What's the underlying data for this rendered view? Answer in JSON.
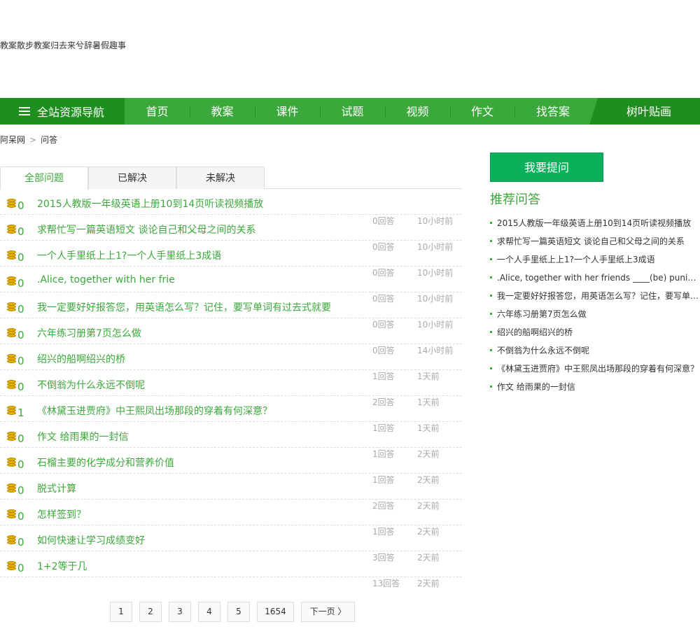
{
  "top_links": "教案散步教案归去来兮辞暑假趣事",
  "nav": {
    "all_label": "全站资源导航",
    "items": [
      "首页",
      "教案",
      "课件",
      "试题",
      "视频",
      "作文",
      "找答案"
    ],
    "right_label": "树叶贴画"
  },
  "breadcrumb": {
    "home": "阿呆网",
    "sep": ">",
    "current": "问答"
  },
  "tabs": [
    "全部问题",
    "已解决",
    "未解决"
  ],
  "questions": [
    {
      "score": "0",
      "title": "2015人教版一年级英语上册10到14页听读视频播放",
      "answers": "0回答",
      "time": "10小时前"
    },
    {
      "score": "0",
      "title": "求帮忙写一篇英语短文 谈论自己和父母之间的关系",
      "answers": "0回答",
      "time": "10小时前"
    },
    {
      "score": "0",
      "title": "一个人手里纸上上1?一个人手里纸上3成语",
      "answers": "0回答",
      "time": "10小时前"
    },
    {
      "score": "0",
      "title": ".Alice, together with her frie",
      "answers": "0回答",
      "time": "10小时前"
    },
    {
      "score": "0",
      "title": "我一定要好好报答您，用英语怎么写？记住，要写单词有过去式就要",
      "answers": "0回答",
      "time": "10小时前"
    },
    {
      "score": "0",
      "title": "六年练习册第7页怎么做",
      "answers": "0回答",
      "time": "14小时前"
    },
    {
      "score": "0",
      "title": "绍兴的船啊绍兴的桥",
      "answers": "1回答",
      "time": "1天前"
    },
    {
      "score": "0",
      "title": "不倒翁为什么永远不倒呢",
      "answers": "2回答",
      "time": "1天前"
    },
    {
      "score": "1",
      "title": "《林黛玉进贾府》中王熙凤出场那段的穿着有何深意？",
      "answers": "1回答",
      "time": "1天前"
    },
    {
      "score": "0",
      "title": "作文 给雨果的一封信",
      "answers": "1回答",
      "time": "2天前"
    },
    {
      "score": "0",
      "title": "石榴主要的化学成分和营养价值",
      "answers": "1回答",
      "time": "2天前"
    },
    {
      "score": "0",
      "title": "脱式计算",
      "answers": "2回答",
      "time": "2天前"
    },
    {
      "score": "0",
      "title": "怎样签到？",
      "answers": "1回答",
      "time": "2天前"
    },
    {
      "score": "0",
      "title": "如何快速让学习成绩变好",
      "answers": "3回答",
      "time": "2天前"
    },
    {
      "score": "0",
      "title": "1+2等于几",
      "answers": "13回答",
      "time": "2天前"
    }
  ],
  "pager": [
    "1",
    "2",
    "3",
    "4",
    "5",
    "1654",
    "下一页 〉"
  ],
  "sidebar": {
    "ask_label": "我要提问",
    "rec_title": "推荐问答",
    "rec_items": [
      "2015人教版一年级英语上册10到14页听读视频播放",
      "求帮忙写一篇英语短文 谈论自己和父母之间的关系",
      "一个人手里纸上上1?一个人手里纸上3成语",
      ".Alice, together with her friends ____(be) punished",
      "我一定要好好报答您，用英语怎么写？记住，要写单词有过去式就要",
      "六年练习册第7页怎么做",
      "绍兴的船啊绍兴的桥",
      "不倒翁为什么永远不倒呢",
      "《林黛玉进贾府》中王熙凤出场那段的穿着有何深意？",
      "作文 给雨果的一封信"
    ]
  },
  "colors": {
    "accent": "#3aa83a",
    "nav_dark": "#1e8e1e",
    "ask_button": "#0db05a"
  }
}
